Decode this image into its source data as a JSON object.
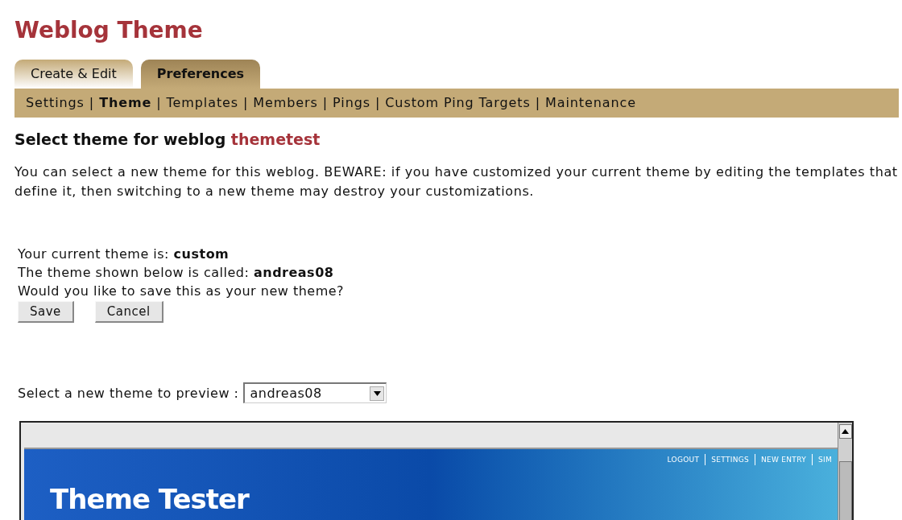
{
  "page_title": "Weblog Theme",
  "tabs": [
    {
      "label": "Create & Edit",
      "selected": false
    },
    {
      "label": "Preferences",
      "selected": true
    }
  ],
  "subnav_separator": "|",
  "subnav": [
    {
      "label": "Settings",
      "selected": false
    },
    {
      "label": "Theme",
      "selected": true
    },
    {
      "label": "Templates",
      "selected": false
    },
    {
      "label": "Members",
      "selected": false
    },
    {
      "label": "Pings",
      "selected": false
    },
    {
      "label": "Custom Ping Targets",
      "selected": false
    },
    {
      "label": "Maintenance",
      "selected": false
    }
  ],
  "heading": {
    "text": "Select theme for weblog",
    "weblog": "themetest"
  },
  "intro": "You can select a new theme for this weblog. BEWARE: if you have customized your current theme by editing the templates that define it, then switching to a new theme may destroy your customizations.",
  "info_lines": [
    "Your current theme is: **custom**",
    "The theme shown below is called: **andreas08**",
    "Would you like to save this as your new theme?"
  ],
  "buttons": [
    "Save",
    "Cancel"
  ],
  "theme_select": {
    "label": "Select a new theme to preview :",
    "value": "andreas08"
  },
  "preview": {
    "nav_links": [
      "LOGOUT",
      "SETTINGS",
      "NEW ENTRY",
      "SIM"
    ],
    "site_title": "Theme Tester"
  }
}
